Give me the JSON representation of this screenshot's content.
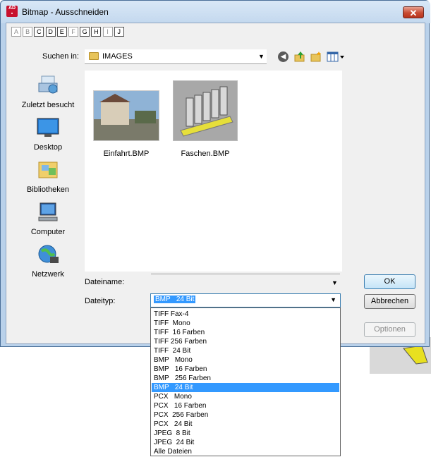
{
  "window": {
    "title": "Bitmap - Ausschneiden",
    "close_label": "✕"
  },
  "drives": [
    "A",
    "B",
    "C",
    "D",
    "E",
    "F",
    "G",
    "H",
    "I",
    "J"
  ],
  "drives_enabled": [
    "C",
    "D",
    "E",
    "G",
    "H",
    "J"
  ],
  "lookin": {
    "label": "Suchen in:",
    "value": "IMAGES"
  },
  "toolbar": {
    "icons": [
      "back-icon",
      "up-folder-icon",
      "new-folder-icon",
      "views-icon"
    ]
  },
  "places": [
    {
      "label": "Zuletzt besucht",
      "icon": "recent-icon"
    },
    {
      "label": "Desktop",
      "icon": "desktop-icon"
    },
    {
      "label": "Bibliotheken",
      "icon": "libraries-icon"
    },
    {
      "label": "Computer",
      "icon": "computer-icon"
    },
    {
      "label": "Netzwerk",
      "icon": "network-icon"
    }
  ],
  "files": [
    {
      "name": "Einfahrt.BMP"
    },
    {
      "name": "Faschen.BMP"
    }
  ],
  "filename": {
    "label": "Dateiname:",
    "value": ""
  },
  "filetype": {
    "label": "Dateityp:",
    "value": "BMP   24 Bit"
  },
  "buttons": {
    "ok": "OK",
    "cancel": "Abbrechen",
    "options": "Optionen"
  },
  "filetype_options": [
    "TIFF Fax-4",
    "TIFF  Mono",
    "TIFF  16 Farben",
    "TIFF 256 Farben",
    "TIFF  24 Bit",
    "BMP   Mono",
    "BMP   16 Farben",
    "BMP   256 Farben",
    "BMP   24 Bit",
    "PCX   Mono",
    "PCX   16 Farben",
    "PCX  256 Farben",
    "PCX   24 Bit",
    "JPEG  8 Bit",
    "JPEG  24 Bit",
    "Alle Dateien"
  ],
  "filetype_selected_index": 8,
  "colors": {
    "selection": "#3399ff",
    "title_close": "#c84b32"
  }
}
